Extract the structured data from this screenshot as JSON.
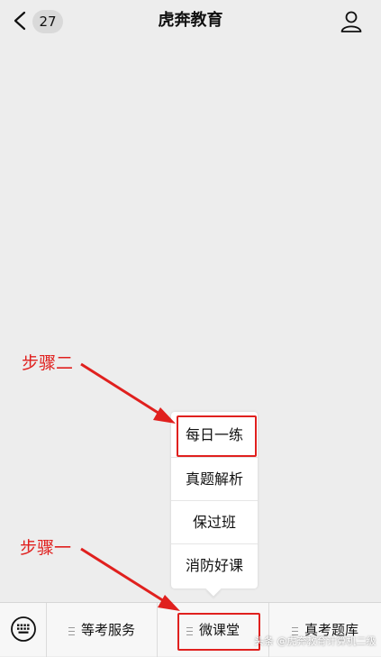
{
  "header": {
    "back_count": "27",
    "title": "虎奔教育"
  },
  "popup_menu": {
    "items": [
      "每日一练",
      "真题解析",
      "保过班",
      "消防好课"
    ]
  },
  "tabbar": {
    "tabs": [
      "等考服务",
      "微课堂",
      "真考题库"
    ]
  },
  "annotations": {
    "step2": "步骤二",
    "step1": "步骤一",
    "color": "#e0201e"
  },
  "watermark": "头条 @虎奔教育计算机二级"
}
